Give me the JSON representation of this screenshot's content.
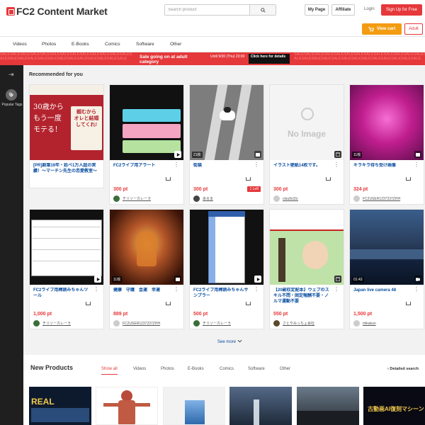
{
  "header": {
    "logo_text": "FC2 Content Market",
    "search_placeholder": "Search product",
    "my_page": "My Page",
    "affiliate": "Affiliate",
    "login": "Login",
    "signup": "Sign Up for Free",
    "view_cart": "View cart",
    "adult": "Adult"
  },
  "categories": [
    "Videos",
    "Photos",
    "E-Books",
    "Comics",
    "Software",
    "Other"
  ],
  "sale_banner": {
    "repeat_text": "SALESALESALESALESALESALESALESALESALESALESALESALESALESALESALESALESALESALESALESALESALESALESALESALESALESALE",
    "main": "Sale going on at adult category",
    "until": "Until 9/30 (Thu) 23:00",
    "detail": "Click here for details"
  },
  "sidebar": {
    "popular_tags": "Popular Tags"
  },
  "recommended": {
    "title": "Recommended for you",
    "items": [
      {
        "title": "[PR]創業19年・延べ1万人超の実績！〜マーチン先生の恋愛教室〜",
        "price": "",
        "seller": "",
        "count": "",
        "icon": "none"
      },
      {
        "title": "FC2ライブ用アラート",
        "price": "300 pt",
        "seller": "チリソーカレーラ",
        "count": "",
        "icon": "play-icon"
      },
      {
        "title": "街猫",
        "price": "300 pt",
        "seller": "あるま",
        "count": "21枚",
        "icon": "photo-icon",
        "left": "1 Left"
      },
      {
        "title": "イラスト壁紙14枚です。",
        "price": "300 pt",
        "seller": "ctsu9o31r",
        "count": "",
        "icon": "photo-icon"
      },
      {
        "title": "キラキラ待ち受け画像",
        "price": "324 pt",
        "seller": "FC2USER1237237ZHH",
        "count": "11枚",
        "icon": "photo-icon"
      },
      {
        "title": "FC2ライブ用棒読みちゃんツール",
        "price": "1,000 pt",
        "seller": "チリソーカレーラ",
        "count": "",
        "icon": "play-icon"
      },
      {
        "title": "健康　守護　金運　幸運",
        "price": "889 pt",
        "seller": "FC2USER1237237ZHH",
        "count": "11枚",
        "icon": "photo-icon"
      },
      {
        "title": "FC2ライブ用棒読みちゃんサンプラー",
        "price": "500 pt",
        "seller": "チリソーカレーラ",
        "count": "",
        "icon": "play-icon"
      },
      {
        "title": "【20副収定配本】ウェブのスキル不問・固定報酬不要・ノルマ運動不要",
        "price": "550 pt",
        "seller": "さとやみっちょ会社",
        "count": "",
        "icon": "photo-icon"
      },
      {
        "title": "Japan live camera 48",
        "price": "1,500 pt",
        "seller": "mikakun",
        "count": "01:43",
        "icon": "video-icon"
      }
    ]
  },
  "see_more": "See more",
  "new_products": {
    "title": "New Products",
    "tabs": [
      "Show all",
      "Videos",
      "Photos",
      "E-Books",
      "Comics",
      "Software",
      "Other"
    ],
    "detail_search": "Detailed search"
  },
  "colors": {
    "brand_red": "#e5383b",
    "cart_orange": "#f39c12",
    "link_blue": "#0a4ea0"
  }
}
